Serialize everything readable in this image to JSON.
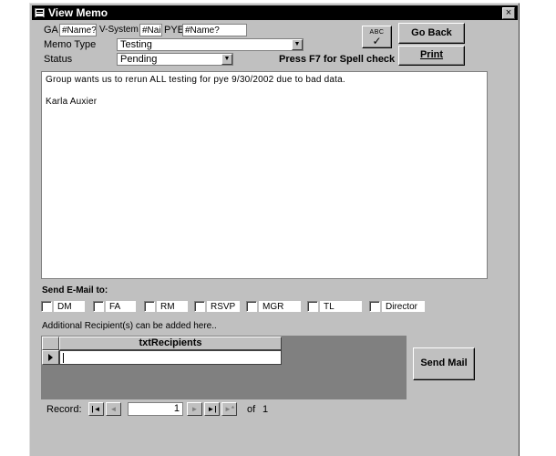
{
  "window": {
    "title": "View Memo",
    "close_glyph": "×"
  },
  "header": {
    "ga_label": "GA",
    "ga_value": "#Name?",
    "vsystem_label": "V-System",
    "vsystem_value": "#Nai",
    "pye_label": "PYE",
    "pye_value": "#Name?",
    "memo_type_label": "Memo Type",
    "memo_type_value": "Testing",
    "status_label": "Status",
    "status_value": "Pending",
    "spell_hint": "Press F7 for Spell check",
    "spell_button_text": "ABC",
    "spell_button_icon": "spellcheck-icon"
  },
  "buttons": {
    "go_back": "Go Back",
    "print": "Print",
    "send_mail": "Send Mail"
  },
  "memo": {
    "line1": "Group wants us to rerun ALL testing for pye 9/30/2002 due to bad data.",
    "line2": "Karla Auxier"
  },
  "email": {
    "heading": "Send E-Mail to:",
    "recipients": [
      "DM",
      "FA",
      "RM",
      "RSVP",
      "MGR",
      "TL",
      "Director"
    ]
  },
  "additional": {
    "caption": "Additional Recipient(s) can be added here..",
    "column_header": "txtRecipients"
  },
  "navigation": {
    "record_label": "Record:",
    "current": "1",
    "of_label": "of",
    "total": "1",
    "first_glyph": "|◄",
    "prev_glyph": "◄",
    "next_glyph": "►",
    "last_glyph": "►|",
    "new_glyph": "►*"
  }
}
